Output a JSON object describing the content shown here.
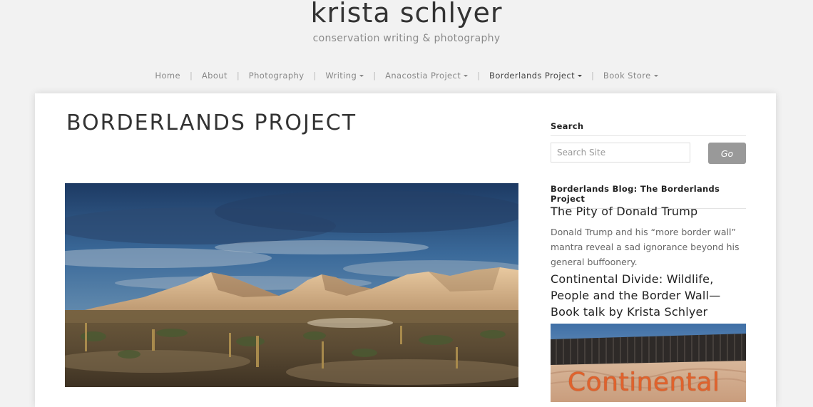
{
  "site": {
    "title": "krista schlyer",
    "tagline": "conservation writing & photography"
  },
  "nav": {
    "items": [
      {
        "label": "Home",
        "has_dropdown": false,
        "active": false
      },
      {
        "label": "About",
        "has_dropdown": false,
        "active": false
      },
      {
        "label": "Photography",
        "has_dropdown": false,
        "active": false
      },
      {
        "label": "Writing",
        "has_dropdown": true,
        "active": false
      },
      {
        "label": "Anacostia Project",
        "has_dropdown": true,
        "active": false
      },
      {
        "label": "Borderlands Project",
        "has_dropdown": true,
        "active": true
      },
      {
        "label": "Book Store",
        "has_dropdown": true,
        "active": false
      }
    ]
  },
  "main": {
    "page_title": "BORDERLANDS PROJECT"
  },
  "sidebar": {
    "search": {
      "title": "Search",
      "placeholder": "Search Site",
      "value": "",
      "button_label": "Go"
    },
    "blog": {
      "title": "Borderlands Blog: The Borderlands Project",
      "posts": [
        {
          "title": "The Pity of Donald Trump",
          "excerpt": "Donald Trump and his “more border wall” mantra reveal a sad ignorance beyond his general buffoonery."
        },
        {
          "title": "Continental Divide: Wildlife, People and the Border Wall—Book talk by Krista Schlyer",
          "thumb_text": "Continental"
        }
      ]
    }
  },
  "colors": {
    "background": "#f2f2f2",
    "card": "#ffffff",
    "button": "#999999",
    "thumb_text": "#e0622c"
  }
}
